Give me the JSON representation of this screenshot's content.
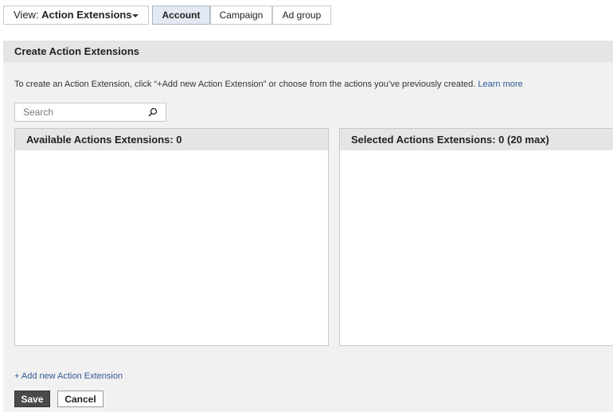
{
  "toolbar": {
    "view_prefix": "View: ",
    "view_value": "Action Extensions",
    "tabs": [
      "Account",
      "Campaign",
      "Ad group"
    ],
    "active_tab": "Account"
  },
  "panel": {
    "title": "Create Action Extensions",
    "intro_text": "To create an Action Extension, click “+Add new Action Extension” or choose from the actions you’ve previously created. ",
    "learn_more": "Learn more",
    "search_placeholder": "Search",
    "available_header": "Available Actions Extensions:  0",
    "selected_header": "Selected Actions Extensions:  0 (20 max)",
    "add_link": "+ Add new Action Extension",
    "save_label": "Save",
    "cancel_label": "Cancel"
  },
  "colors": {
    "link": "#2f5a95",
    "active_tab_bg": "#e3e9f2",
    "save_bg": "#4a4a4a"
  }
}
